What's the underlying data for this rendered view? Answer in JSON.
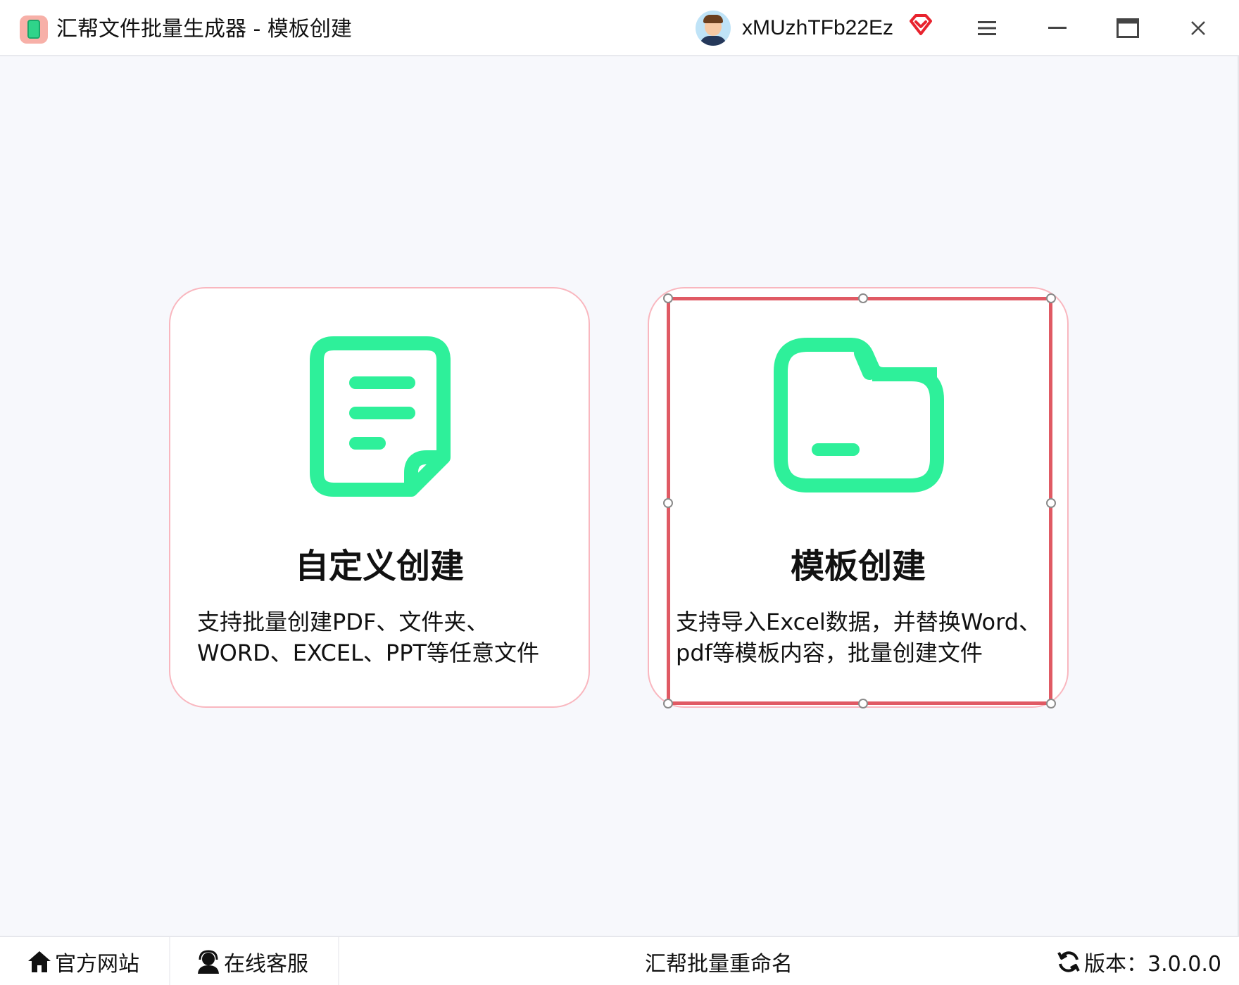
{
  "window": {
    "title": "汇帮文件批量生成器 - 模板创建",
    "username": "xMUzhTFb22Ez"
  },
  "cards": [
    {
      "id": "custom",
      "title": "自定义创建",
      "desc_line1": "支持批量创建PDF、文件夹、",
      "desc_line2": "WORD、EXCEL、PPT等任意文件",
      "icon": "document-icon"
    },
    {
      "id": "template",
      "title": "模板创建",
      "desc_line1": "支持导入Excel数据，并替换Word、",
      "desc_line2": "pdf等模板内容，批量创建文件",
      "icon": "folder-icon",
      "selected": true
    }
  ],
  "bottom": {
    "website_label": "官方网站",
    "support_label": "在线客服",
    "rename_label": "汇帮批量重命名",
    "version_label": "版本：3.0.0.0"
  },
  "colors": {
    "accent_green": "#2ef09a",
    "card_border": "#f9b7bf",
    "selection_red": "#e05a64",
    "vip_red": "#e8232e",
    "background": "#f7f8fc"
  }
}
